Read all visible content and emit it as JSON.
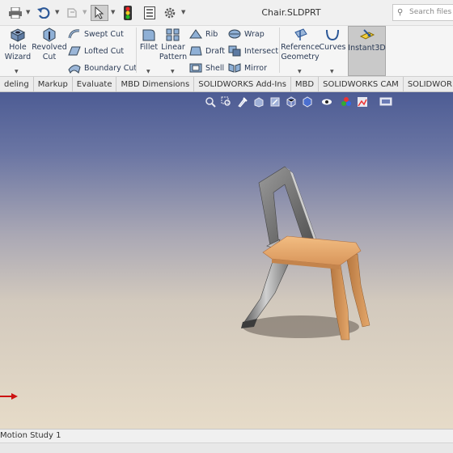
{
  "window": {
    "title": "Chair.SLDPRT",
    "search_placeholder": "Search files an"
  },
  "ribbon": {
    "hole_wizard": "Hole\nWizard",
    "revolved_cut": "Revolved\nCut",
    "swept_cut": "Swept Cut",
    "lofted_cut": "Lofted Cut",
    "boundary_cut": "Boundary Cut",
    "fillet": "Fillet",
    "linear_pattern": "Linear\nPattern",
    "rib": "Rib",
    "draft": "Draft",
    "shell": "Shell",
    "wrap": "Wrap",
    "intersect": "Intersect",
    "mirror": "Mirror",
    "reference_geometry": "Reference\nGeometry",
    "curves": "Curves",
    "instant3d": "Instant3D"
  },
  "tabs": [
    "deling",
    "Markup",
    "Evaluate",
    "MBD Dimensions",
    "SOLIDWORKS Add-Ins",
    "MBD",
    "SOLIDWORKS CAM",
    "SOLIDWORKS CAM TB"
  ],
  "bottom": {
    "motion_tab": "Motion Study 1"
  },
  "colors": {
    "accent_blue": "#2b5797",
    "seat_wood": "#e5a86b",
    "frame_metal": "#8a8a8a",
    "axis_red": "#cc1111"
  },
  "icons": {
    "print": "printer-icon",
    "undo": "undo-icon",
    "redo": "redo-icon",
    "select": "pointer-icon",
    "rebuild": "traffic-light-icon",
    "file_props": "file-properties-icon",
    "options": "gear-icon",
    "search": "search-icon"
  }
}
